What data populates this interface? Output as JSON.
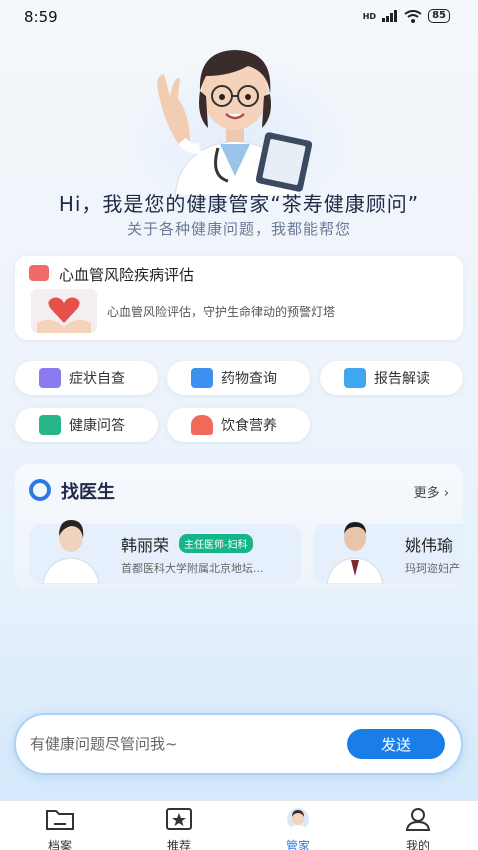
{
  "status": {
    "time": "8:59",
    "battery": "85",
    "network": "HD"
  },
  "hero": {
    "greeting": "Hi，我是您的健康管家“茶寿健康顾问”",
    "subtitle": "关于各种健康问题，我都能帮您"
  },
  "risk_card": {
    "title": "心血管风险疾病评估",
    "description": "心血管风险评估，守护生命律动的预警灯塔"
  },
  "quick_actions": [
    {
      "label": "症状自查",
      "icon": "symptom-search-icon",
      "color": "#8a7cf0"
    },
    {
      "label": "药物查询",
      "icon": "medicine-icon",
      "color": "#3d8ff0"
    },
    {
      "label": "报告解读",
      "icon": "report-icon",
      "color": "#3fa7f0"
    },
    {
      "label": "健康问答",
      "icon": "qa-icon",
      "color": "#27b58a"
    },
    {
      "label": "饮食营养",
      "icon": "food-icon",
      "color": "#f06a5a"
    }
  ],
  "doctors": {
    "title": "找医生",
    "more": "更多",
    "items": [
      {
        "name": "韩丽荣",
        "badge": "主任医师-妇科",
        "hospital": "首都医科大学附属北京地坛..."
      },
      {
        "name": "姚伟瑜",
        "badge": "",
        "hospital": "玛珂迩妇产"
      }
    ]
  },
  "input": {
    "placeholder": "有健康问题尽管问我~",
    "send": "发送"
  },
  "tabs": [
    {
      "label": "档案",
      "icon": "folder-icon"
    },
    {
      "label": "推荐",
      "icon": "star-icon"
    },
    {
      "label": "管家",
      "icon": "assistant-avatar-icon"
    },
    {
      "label": "我的",
      "icon": "user-icon"
    }
  ]
}
